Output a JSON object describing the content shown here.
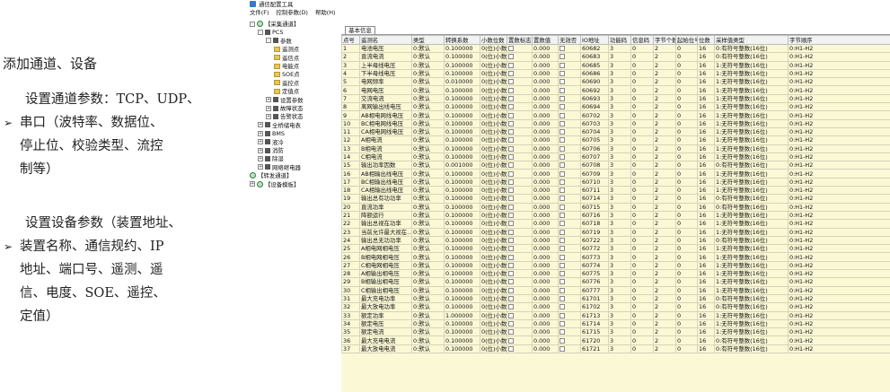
{
  "left": {
    "heading": "添加通道、设备",
    "block1": {
      "marker": "➢",
      "lines": [
        "设置通道参数：TCP、UDP、",
        "串口（波特率、数据位、",
        "停止位、校验类型、流控",
        "制等）"
      ]
    },
    "block2": {
      "marker": "➢",
      "lines": [
        "设置设备参数（装置地址、",
        "装置名称、通信规约、IP",
        "地址、端口号、遥测、遥",
        "信、电度、SOE、遥控、",
        "定值）"
      ]
    }
  },
  "window": {
    "title": "通信配置工具",
    "menu": [
      "文件(F)",
      "控制参数(D)",
      "帮助(H)"
    ],
    "tab": "基本信息"
  },
  "tree": [
    {
      "label": "【采集通道】",
      "level": 0,
      "exp": "⊟",
      "icon": "gear-icon"
    },
    {
      "label": "PCS",
      "level": 1,
      "exp": "⊟",
      "icon": "device-icon"
    },
    {
      "label": "参数",
      "level": 2,
      "exp": "⊟",
      "icon": "device-icon"
    },
    {
      "label": "遥测点",
      "level": 3,
      "exp": "",
      "icon": "folder-icon"
    },
    {
      "label": "遥信点",
      "level": 3,
      "exp": "",
      "icon": "folder-icon"
    },
    {
      "label": "电能点",
      "level": 3,
      "exp": "",
      "icon": "folder-icon"
    },
    {
      "label": "SOE点",
      "level": 3,
      "exp": "",
      "icon": "folder-icon"
    },
    {
      "label": "遥控点",
      "level": 3,
      "exp": "",
      "icon": "folder-icon"
    },
    {
      "label": "定值点",
      "level": 3,
      "exp": "",
      "icon": "folder-icon"
    },
    {
      "label": "设置参数",
      "level": 2,
      "exp": "⊞",
      "icon": "device-icon"
    },
    {
      "label": "故障状态",
      "level": 2,
      "exp": "⊞",
      "icon": "device-icon"
    },
    {
      "label": "告警状态",
      "level": 2,
      "exp": "⊞",
      "icon": "device-icon"
    },
    {
      "label": "全桥储电表",
      "level": 1,
      "exp": "⊞",
      "icon": "device-icon"
    },
    {
      "label": "BMS",
      "level": 1,
      "exp": "⊞",
      "icon": "device-icon"
    },
    {
      "label": "液冷",
      "level": 1,
      "exp": "⊞",
      "icon": "device-icon"
    },
    {
      "label": "消防",
      "level": 1,
      "exp": "⊞",
      "icon": "device-icon"
    },
    {
      "label": "除湿",
      "level": 1,
      "exp": "⊞",
      "icon": "device-icon"
    },
    {
      "label": "网络继电器",
      "level": 1,
      "exp": "⊞",
      "icon": "device-icon"
    },
    {
      "label": "【转发通道】",
      "level": 0,
      "exp": "",
      "icon": "gear-icon"
    },
    {
      "label": "【设备模板】",
      "level": 0,
      "exp": "⊞",
      "icon": "gear-icon"
    }
  ],
  "columns": [
    "点号",
    "遥测名",
    "类型",
    "转换系数",
    "小数位数",
    "置数标志",
    "置数值",
    "无效否",
    "IO地址",
    "功能码",
    "信息码",
    "字节个数",
    "起始位号",
    "位数",
    "采样值类型",
    "字节顺序"
  ],
  "rows": [
    [
      "1",
      "电池电压",
      "0:默认",
      "0.100000",
      "0(位)小数",
      "",
      "0.000",
      "",
      "60682",
      "3",
      "0",
      "2",
      "0",
      "16",
      "0:有符号整数(16位)",
      "0:H1-H2"
    ],
    [
      "2",
      "直流电流",
      "0:默认",
      "0.100000",
      "0(位)小数",
      "",
      "0.000",
      "",
      "60683",
      "3",
      "0",
      "2",
      "0",
      "16",
      "0:有符号整数(16位)",
      "0:H1-H2"
    ],
    [
      "3",
      "上半母线电压",
      "0:默认",
      "0.100000",
      "0(位)小数",
      "",
      "0.000",
      "",
      "60685",
      "3",
      "0",
      "2",
      "0",
      "16",
      "1:无符号整数(16位)",
      "0:H1-H2"
    ],
    [
      "4",
      "下半母线电压",
      "0:默认",
      "0.100000",
      "0(位)小数",
      "",
      "0.000",
      "",
      "60686",
      "3",
      "0",
      "2",
      "0",
      "16",
      "1:无符号整数(16位)",
      "0:H1-H2"
    ],
    [
      "5",
      "电网频率",
      "0:默认",
      "0.010000",
      "0(位)小数",
      "",
      "0.000",
      "",
      "60690",
      "3",
      "0",
      "2",
      "0",
      "16",
      "1:无符号整数(16位)",
      "0:H1-H2"
    ],
    [
      "6",
      "电网电压",
      "0:默认",
      "0.100000",
      "0(位)小数",
      "",
      "0.000",
      "",
      "60692",
      "3",
      "0",
      "2",
      "0",
      "16",
      "1:无符号整数(16位)",
      "0:H1-H2"
    ],
    [
      "7",
      "交流电流",
      "0:默认",
      "0.100000",
      "0(位)小数",
      "",
      "0.000",
      "",
      "60693",
      "3",
      "0",
      "2",
      "0",
      "16",
      "1:无符号整数(16位)",
      "0:H1-H2"
    ],
    [
      "8",
      "离网输出线电压",
      "0:默认",
      "0.100000",
      "0(位)小数",
      "",
      "0.000",
      "",
      "60694",
      "3",
      "0",
      "2",
      "0",
      "16",
      "1:无符号整数(16位)",
      "0:H1-H2"
    ],
    [
      "9",
      "AB相电网线电压",
      "0:默认",
      "0.100000",
      "0(位)小数",
      "",
      "0.000",
      "",
      "60702",
      "3",
      "0",
      "2",
      "0",
      "16",
      "1:无符号整数(16位)",
      "0:H1-H2"
    ],
    [
      "10",
      "BC相电网线电压",
      "0:默认",
      "0.100000",
      "0(位)小数",
      "",
      "0.000",
      "",
      "60703",
      "3",
      "0",
      "2",
      "0",
      "16",
      "1:无符号整数(16位)",
      "0:H1-H2"
    ],
    [
      "11",
      "CA相电网线电压",
      "0:默认",
      "0.100000",
      "0(位)小数",
      "",
      "0.000",
      "",
      "60704",
      "3",
      "0",
      "2",
      "0",
      "16",
      "1:无符号整数(16位)",
      "0:H1-H2"
    ],
    [
      "12",
      "A相电流",
      "0:默认",
      "0.100000",
      "0(位)小数",
      "",
      "0.000",
      "",
      "60705",
      "3",
      "0",
      "2",
      "0",
      "16",
      "1:无符号整数(16位)",
      "0:H1-H2"
    ],
    [
      "13",
      "B相电流",
      "0:默认",
      "0.100000",
      "0(位)小数",
      "",
      "0.000",
      "",
      "60706",
      "3",
      "0",
      "2",
      "0",
      "16",
      "1:无符号整数(16位)",
      "0:H1-H2"
    ],
    [
      "14",
      "C相电流",
      "0:默认",
      "0.100000",
      "0(位)小数",
      "",
      "0.000",
      "",
      "60707",
      "3",
      "0",
      "2",
      "0",
      "16",
      "1:无符号整数(16位)",
      "0:H1-H2"
    ],
    [
      "15",
      "输出功率因数",
      "0:默认",
      "0.001000",
      "0(位)小数",
      "",
      "0.000",
      "",
      "60708",
      "3",
      "0",
      "2",
      "0",
      "16",
      "0:有符号整数(16位)",
      "0:H1-H2"
    ],
    [
      "16",
      "AB相输出线电压",
      "0:默认",
      "0.100000",
      "0(位)小数",
      "",
      "0.000",
      "",
      "60709",
      "3",
      "0",
      "2",
      "0",
      "16",
      "1:无符号整数(16位)",
      "0:H1-H2"
    ],
    [
      "17",
      "BC相输出线电压",
      "0:默认",
      "0.100000",
      "0(位)小数",
      "",
      "0.000",
      "",
      "60710",
      "3",
      "0",
      "2",
      "0",
      "16",
      "1:无符号整数(16位)",
      "0:H1-H2"
    ],
    [
      "18",
      "CA相输出线电压",
      "0:默认",
      "0.100000",
      "0(位)小数",
      "",
      "0.000",
      "",
      "60711",
      "3",
      "0",
      "2",
      "0",
      "16",
      "1:无符号整数(16位)",
      "0:H1-H2"
    ],
    [
      "19",
      "输出总有功功率",
      "0:默认",
      "0.100000",
      "0(位)小数",
      "",
      "0.000",
      "",
      "60714",
      "3",
      "0",
      "2",
      "0",
      "16",
      "0:有符号整数(16位)",
      "0:H1-H2"
    ],
    [
      "20",
      "直流功率",
      "0:默认",
      "0.100000",
      "0(位)小数",
      "",
      "0.000",
      "",
      "60715",
      "3",
      "0",
      "2",
      "0",
      "16",
      "0:有符号整数(16位)",
      "0:H1-H2"
    ],
    [
      "21",
      "降额运行",
      "0:默认",
      "0.100000",
      "0(位)小数",
      "",
      "0.000",
      "",
      "60716",
      "3",
      "0",
      "2",
      "0",
      "16",
      "1:无符号整数(16位)",
      "0:H1-H2"
    ],
    [
      "22",
      "输出总视在功率",
      "0:默认",
      "0.100000",
      "0(位)小数",
      "",
      "0.000",
      "",
      "60718",
      "3",
      "0",
      "2",
      "0",
      "16",
      "1:无符号整数(16位)",
      "0:H1-H2"
    ],
    [
      "23",
      "当前允许最大视在...",
      "0:默认",
      "0.100000",
      "0(位)小数",
      "",
      "0.000",
      "",
      "60719",
      "3",
      "0",
      "2",
      "0",
      "16",
      "1:无符号整数(16位)",
      "0:H1-H2"
    ],
    [
      "24",
      "输出总无功功率",
      "0:默认",
      "0.100000",
      "0(位)小数",
      "",
      "0.000",
      "",
      "60722",
      "3",
      "0",
      "2",
      "0",
      "16",
      "0:有符号整数(16位)",
      "0:H1-H2"
    ],
    [
      "25",
      "A相电网相电压",
      "0:默认",
      "0.100000",
      "0(位)小数",
      "",
      "0.000",
      "",
      "60772",
      "3",
      "0",
      "2",
      "0",
      "16",
      "1:无符号整数(16位)",
      "0:H1-H2"
    ],
    [
      "26",
      "B相电网相电压",
      "0:默认",
      "0.100000",
      "0(位)小数",
      "",
      "0.000",
      "",
      "60773",
      "3",
      "0",
      "2",
      "0",
      "16",
      "1:无符号整数(16位)",
      "0:H1-H2"
    ],
    [
      "27",
      "C相电网相电压",
      "0:默认",
      "0.100000",
      "0(位)小数",
      "",
      "0.000",
      "",
      "60774",
      "3",
      "0",
      "2",
      "0",
      "16",
      "1:无符号整数(16位)",
      "0:H1-H2"
    ],
    [
      "28",
      "A相输出相电压",
      "0:默认",
      "0.100000",
      "0(位)小数",
      "",
      "0.000",
      "",
      "60775",
      "3",
      "0",
      "2",
      "0",
      "16",
      "1:无符号整数(16位)",
      "0:H1-H2"
    ],
    [
      "29",
      "B相输出相电压",
      "0:默认",
      "0.100000",
      "0(位)小数",
      "",
      "0.000",
      "",
      "60776",
      "3",
      "0",
      "2",
      "0",
      "16",
      "1:无符号整数(16位)",
      "0:H1-H2"
    ],
    [
      "30",
      "C相输出相电压",
      "0:默认",
      "0.100000",
      "0(位)小数",
      "",
      "0.000",
      "",
      "60777",
      "3",
      "0",
      "2",
      "0",
      "16",
      "1:无符号整数(16位)",
      "0:H1-H2"
    ],
    [
      "31",
      "最大充电功率",
      "0:默认",
      "0.100000",
      "0(位)小数",
      "",
      "0.000",
      "",
      "61701",
      "3",
      "0",
      "2",
      "0",
      "16",
      "0:有符号整数(16位)",
      "0:H1-H2"
    ],
    [
      "32",
      "最大放电功率",
      "0:默认",
      "0.100000",
      "0(位)小数",
      "",
      "0.000",
      "",
      "61702",
      "3",
      "0",
      "2",
      "0",
      "16",
      "0:有符号整数(16位)",
      "0:H1-H2"
    ],
    [
      "33",
      "额定功率",
      "0:默认",
      "1.000000",
      "0(位)小数",
      "",
      "0.000",
      "",
      "61713",
      "3",
      "0",
      "2",
      "0",
      "16",
      "1:无符号整数(16位)",
      "0:H1-H2"
    ],
    [
      "34",
      "额定电压",
      "0:默认",
      "0.100000",
      "0(位)小数",
      "",
      "0.000",
      "",
      "61714",
      "3",
      "0",
      "2",
      "0",
      "16",
      "1:无符号整数(16位)",
      "0:H1-H2"
    ],
    [
      "35",
      "额定电流",
      "0:默认",
      "0.100000",
      "0(位)小数",
      "",
      "0.000",
      "",
      "61715",
      "3",
      "0",
      "2",
      "0",
      "16",
      "1:无符号整数(16位)",
      "0:H1-H2"
    ],
    [
      "36",
      "最大充电电流",
      "0:默认",
      "0.100000",
      "0(位)小数",
      "",
      "0.000",
      "",
      "61720",
      "3",
      "0",
      "2",
      "0",
      "16",
      "0:有符号整数(16位)",
      "0:H1-H2"
    ],
    [
      "37",
      "最大放电电流",
      "0:默认",
      "0.100000",
      "0(位)小数",
      "",
      "0.000",
      "",
      "61721",
      "3",
      "0",
      "2",
      "0",
      "16",
      "0:有符号整数(16位)",
      "0:H1-H2"
    ]
  ]
}
